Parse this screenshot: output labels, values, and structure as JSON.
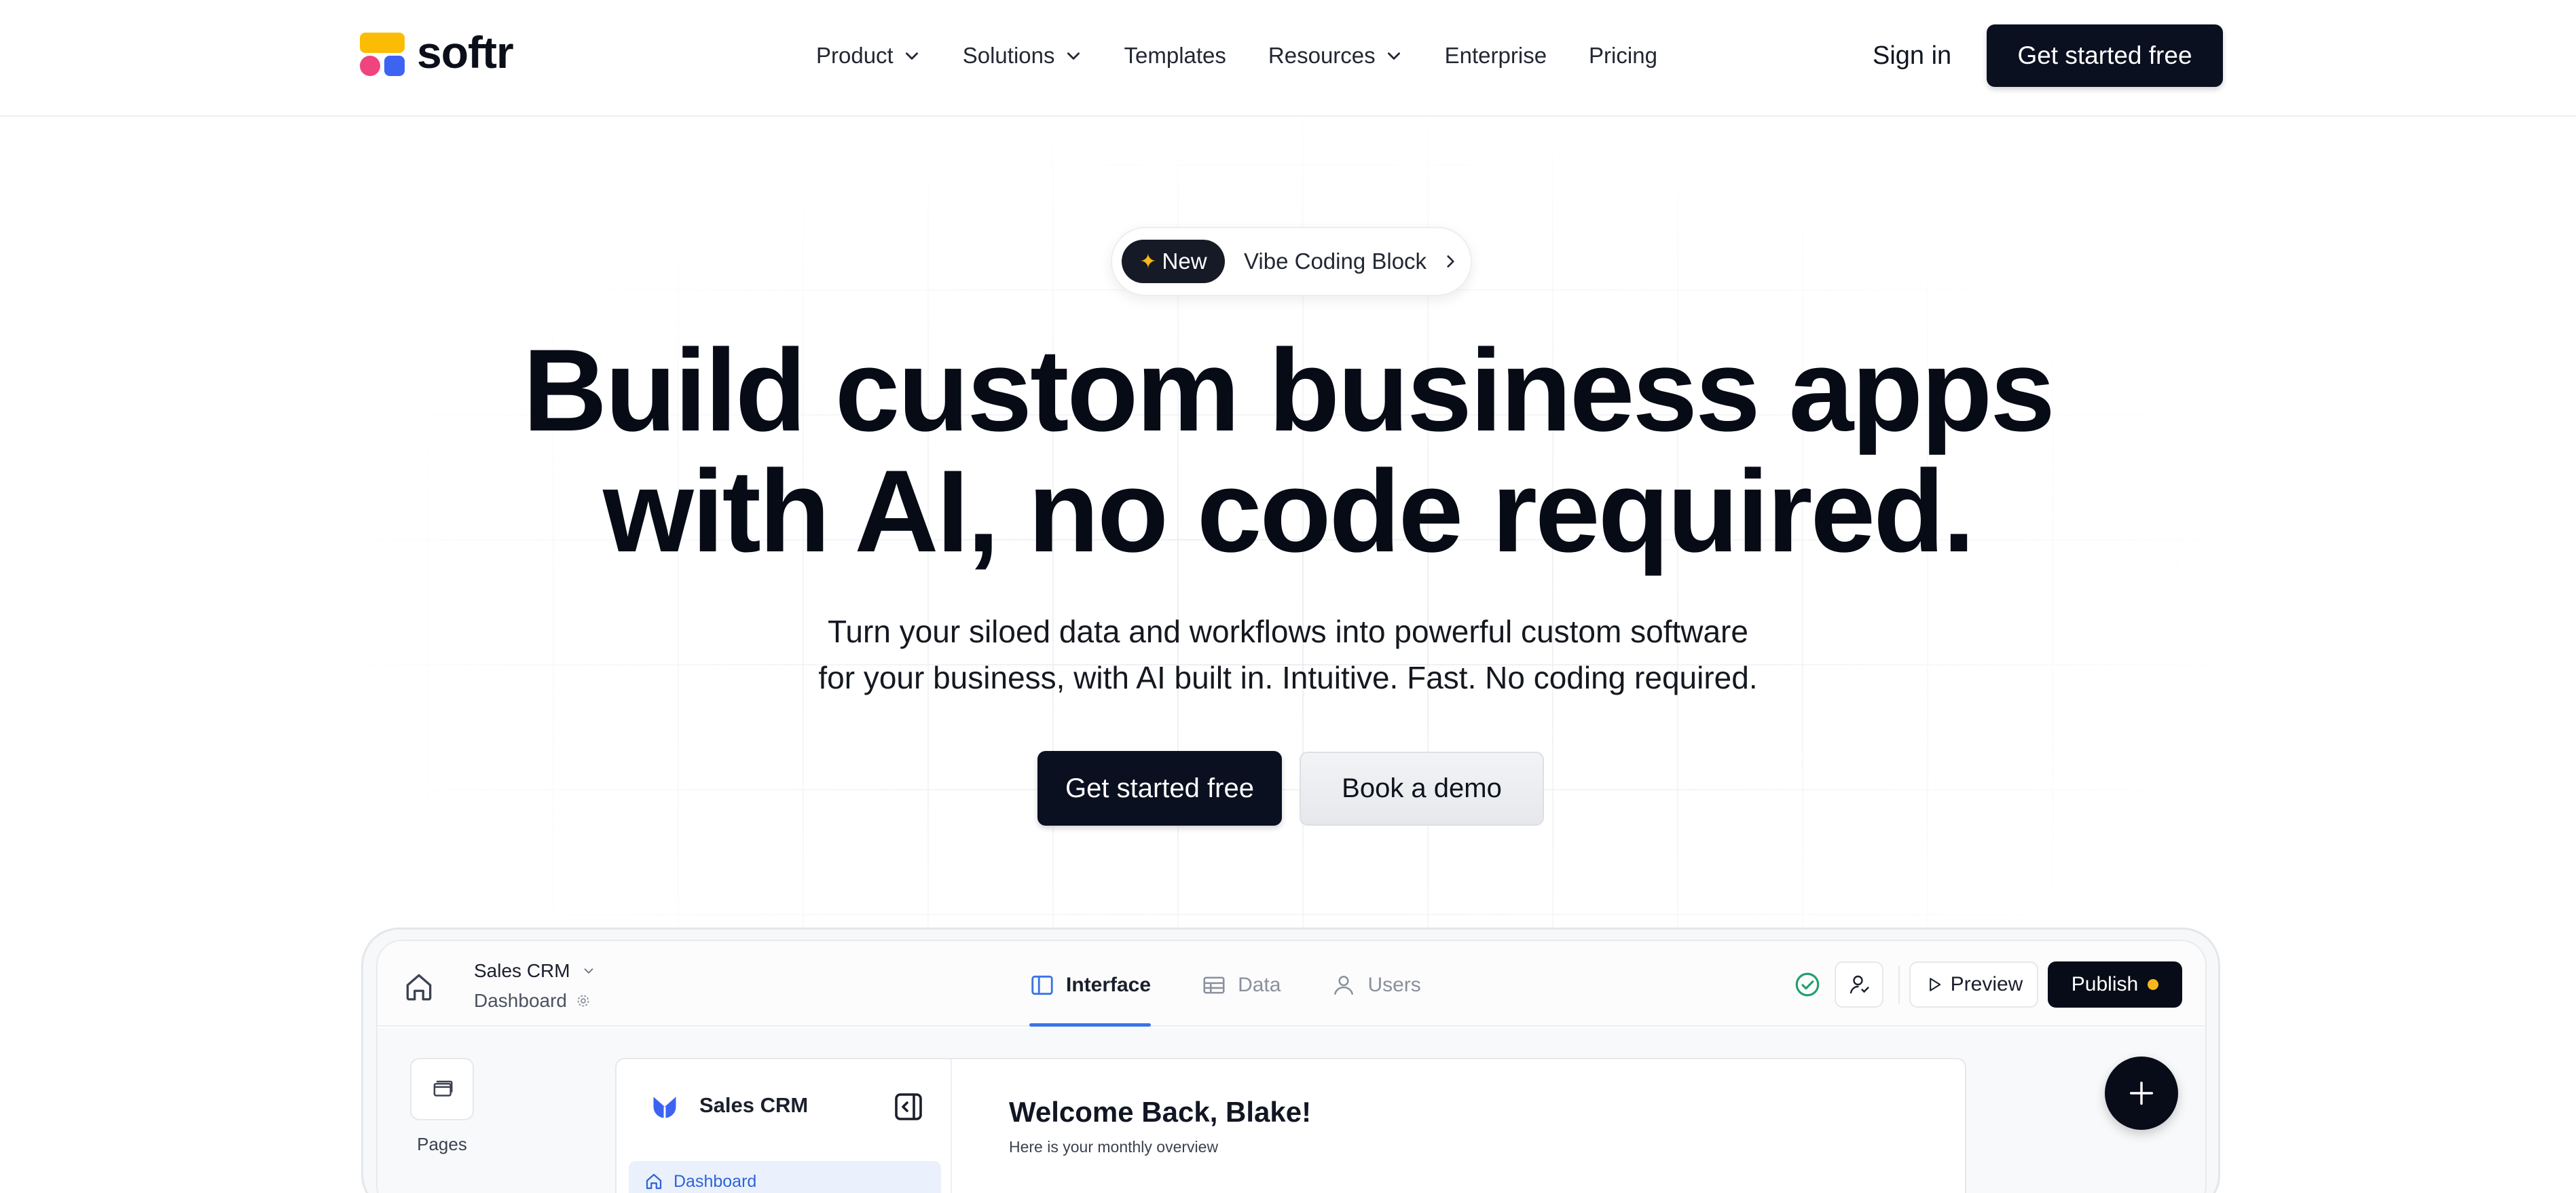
{
  "brand": {
    "name": "softr",
    "colors": {
      "yellow": "#fbbc05",
      "pink": "#f0447e",
      "blue": "#3d63f2"
    }
  },
  "nav": {
    "items": [
      {
        "label": "Product",
        "has_dropdown": true
      },
      {
        "label": "Solutions",
        "has_dropdown": true
      },
      {
        "label": "Templates",
        "has_dropdown": false
      },
      {
        "label": "Resources",
        "has_dropdown": true
      },
      {
        "label": "Enterprise",
        "has_dropdown": false
      },
      {
        "label": "Pricing",
        "has_dropdown": false
      }
    ],
    "sign_in": "Sign in",
    "cta": "Get started free"
  },
  "announcement": {
    "badge": "New",
    "badge_icon": "sparkle-icon",
    "text": "Vibe Coding Block",
    "arrow_icon": "chevron-right-icon"
  },
  "hero": {
    "headline_line1": "Build custom business apps",
    "headline_line2": "with AI, no code required.",
    "sub_line1": "Turn your siloed data and workflows into powerful custom software",
    "sub_line2": "for your business, with AI built in. Intuitive. Fast. No coding required.",
    "primary_cta": "Get started free",
    "secondary_cta": "Book a demo"
  },
  "app_preview": {
    "project_name": "Sales CRM",
    "current_page": "Dashboard",
    "tabs": [
      {
        "label": "Interface",
        "icon": "layout-icon",
        "active": true
      },
      {
        "label": "Data",
        "icon": "table-icon",
        "active": false
      },
      {
        "label": "Users",
        "icon": "user-icon",
        "active": false
      }
    ],
    "preview_label": "Preview",
    "publish_label": "Publish",
    "status_color": "#f6b81c",
    "pages_label": "Pages",
    "sidebar": {
      "title": "Sales CRM",
      "items": [
        {
          "label": "Dashboard",
          "icon": "home-icon",
          "active": true
        }
      ]
    },
    "main": {
      "welcome": "Welcome Back, Blake!",
      "subtitle": "Here is your monthly overview"
    }
  }
}
